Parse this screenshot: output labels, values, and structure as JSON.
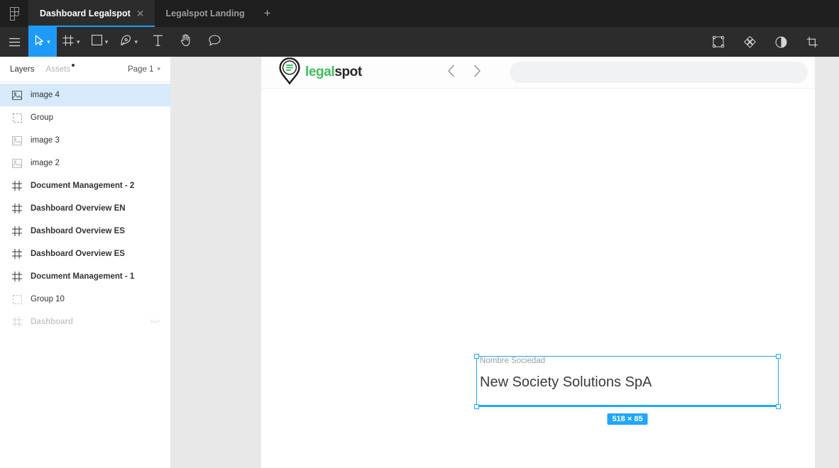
{
  "colors": {
    "accent": "#1e9bfa",
    "selection": "#1ea7fd",
    "tabbar_bg": "#1e1e1e",
    "toolbar_bg": "#2c2c2c",
    "brand_green": "#3cbf5e",
    "brand_dark": "#262626",
    "selected_layer_bg": "#d6eafc"
  },
  "app": {
    "logo_icon": "figma-logo-icon"
  },
  "tabs": {
    "items": [
      {
        "label": "Dashboard Legalspot",
        "active": true,
        "close_icon": "close-icon"
      },
      {
        "label": "Legalspot Landing",
        "active": false
      }
    ],
    "add_label": "+"
  },
  "toolbar": {
    "left_tools": [
      {
        "name": "main-menu",
        "icon": "hamburger-menu-icon",
        "label": "",
        "caret": false,
        "active": false
      },
      {
        "name": "move-tool",
        "icon": "cursor-arrow-icon",
        "label": "",
        "caret": true,
        "active": true
      },
      {
        "name": "frame-tool",
        "icon": "frame-icon",
        "label": "",
        "caret": true,
        "active": false
      },
      {
        "name": "shape-tool",
        "icon": "square-icon",
        "label": "",
        "caret": true,
        "active": false
      },
      {
        "name": "pen-tool",
        "icon": "pen-icon",
        "label": "",
        "caret": true,
        "active": false
      },
      {
        "name": "text-tool",
        "icon": "text-t-icon",
        "label": "",
        "caret": false,
        "active": false
      },
      {
        "name": "hand-tool",
        "icon": "hand-icon",
        "label": "",
        "caret": false,
        "active": false
      },
      {
        "name": "comment-tool",
        "icon": "comment-bubble-icon",
        "label": "",
        "caret": false,
        "active": false
      }
    ],
    "right_tools": [
      {
        "name": "components-tool",
        "icon": "component-icon"
      },
      {
        "name": "plugins-tool",
        "icon": "diamond-grid-icon"
      },
      {
        "name": "contrast-tool",
        "icon": "contrast-circle-icon"
      },
      {
        "name": "crop-tool",
        "icon": "crop-icon"
      }
    ]
  },
  "panel": {
    "tab_layers": "Layers",
    "tab_assets": "Assets",
    "assets_has_dot": true,
    "page_selector": "Page 1",
    "layers": [
      {
        "name": "image 4",
        "icon": "image-icon",
        "bold": false,
        "selected": true,
        "dim": false,
        "hidden": false
      },
      {
        "name": "Group",
        "icon": "group-icon",
        "bold": false,
        "selected": false,
        "dim": false,
        "hidden": false
      },
      {
        "name": "image 3",
        "icon": "image-icon",
        "bold": false,
        "selected": false,
        "dim": false,
        "hidden": false
      },
      {
        "name": "image 2",
        "icon": "image-icon",
        "bold": false,
        "selected": false,
        "dim": false,
        "hidden": false
      },
      {
        "name": "Document Management - 2",
        "icon": "frame-icon",
        "bold": true,
        "selected": false,
        "dim": false,
        "hidden": false
      },
      {
        "name": "Dashboard Overview EN",
        "icon": "frame-icon",
        "bold": true,
        "selected": false,
        "dim": false,
        "hidden": false
      },
      {
        "name": "Dashboard Overview ES",
        "icon": "frame-icon",
        "bold": true,
        "selected": false,
        "dim": false,
        "hidden": false
      },
      {
        "name": "Dashboard Overview ES",
        "icon": "frame-icon",
        "bold": true,
        "selected": false,
        "dim": false,
        "hidden": false
      },
      {
        "name": "Document Management - 1",
        "icon": "frame-icon",
        "bold": true,
        "selected": false,
        "dim": false,
        "hidden": false
      },
      {
        "name": "Group 10",
        "icon": "group-icon",
        "bold": false,
        "selected": false,
        "dim": false,
        "hidden": false
      },
      {
        "name": "Dashboard",
        "icon": "frame-icon",
        "bold": true,
        "selected": false,
        "dim": true,
        "hidden": true
      }
    ]
  },
  "artboard": {
    "logo": {
      "icon": "legalspot-pin-icon",
      "word_green": "legal",
      "word_dark": "spot"
    },
    "nav": {
      "back_icon": "chevron-left-icon",
      "forward_icon": "chevron-right-icon"
    },
    "search": {
      "placeholder": ""
    }
  },
  "selection": {
    "field_label": "Nombre Sociedad",
    "field_value": "New Society Solutions SpA",
    "size_badge": "518 × 85"
  }
}
